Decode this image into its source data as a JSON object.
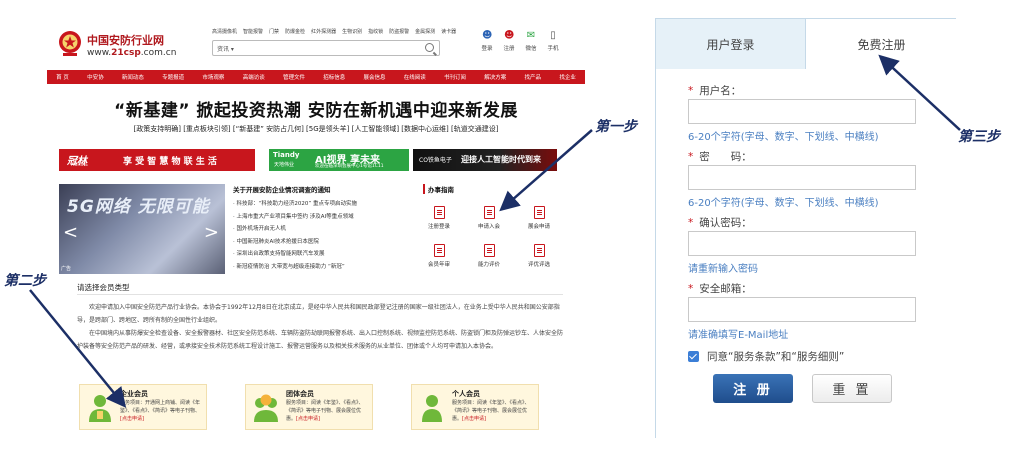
{
  "site": {
    "logo_text": "中国安防行业网",
    "logo_url_prefix": "www.",
    "logo_url_brand": "21csp",
    "logo_url_suffix": ".com.cn",
    "top_links": [
      "高清摄像机",
      "智能报警",
      "门禁",
      "防爆金检",
      "红外探测器",
      "生物识别",
      "指纹锁",
      "防盗报警",
      "金属探测",
      "读卡器"
    ],
    "search_select": "资讯",
    "user_icons": [
      {
        "label": "登录",
        "icon": "person-icon",
        "color": "#2b63b5"
      },
      {
        "label": "注册",
        "icon": "person-add-icon",
        "color": "#c8161d"
      },
      {
        "label": "微信",
        "icon": "wechat-icon",
        "color": "#2ca443"
      },
      {
        "label": "手机",
        "icon": "phone-icon",
        "color": "#555555"
      }
    ],
    "nav": [
      "首 页",
      "中安协",
      "新闻动态",
      "专题报道",
      "市场观察",
      "高端访谈",
      "管理文件",
      "招标信息",
      "展会信息",
      "在线阅读",
      "书刊订阅",
      "解决方案",
      "找产品",
      "找企业"
    ],
    "headline": "“新基建” 掀起投资热潮 安防在新机遇中迎来新发展",
    "subhead": "[政策支持明确] [重点板块引领] [“新基建” 安防占几何] [5G是领头羊] [人工智能领域] [数据中心运维] [轨道交通建设]",
    "sublinks": "",
    "ads": {
      "ad1_brand": "冠林",
      "ad1_brand_en": "AURINE",
      "ad1_slogan": "享 受 智 慧 物 联 生 活",
      "ad2_brand": "Tiandy",
      "ad2_brand_cn": "天地伟业",
      "ad2_title": "AI视界 享未来",
      "ad2_sub": "欢迎莅临深圳会展中心1号馆1C11",
      "ad3_brand": "CO铁鱼电子",
      "ad3_slogan": "迎接人工智能时代到来"
    },
    "banner": {
      "text": "5G网络 无限可能",
      "tag": "广告",
      "prev": "<",
      "next": ">"
    },
    "news": {
      "lead": "关于开展安防企业情况调查的通知",
      "items": [
        "科技部：“科技助力经济2020” 重点专项启动实施",
        "上海市重大产业项目集中签约 涉及AI等重点领域",
        "国外机场开启无人机",
        "中国新冠肺炎AI技术抢援日本医院",
        "深圳出台政策支持智能网联汽车发展",
        "新冠疫情防治 大带宽与超级连接助力 “新冠”"
      ]
    },
    "guide": {
      "title": "办事指南",
      "items": [
        {
          "label": "注册登录",
          "icon": "register-doc-icon"
        },
        {
          "label": "申请入会",
          "icon": "apply-doc-icon"
        },
        {
          "label": "展会申请",
          "icon": "exhibit-doc-icon"
        },
        {
          "label": "会员年审",
          "icon": "review-doc-icon"
        },
        {
          "label": "能力评价",
          "icon": "evaluate-doc-icon"
        },
        {
          "label": "评优评选",
          "icon": "award-doc-icon"
        }
      ]
    },
    "select_title": "请选择会员类型",
    "intro": [
      "欢迎申请加入中国安全防范产品行业协会。本协会于1992年12月8日在北京成立，是经中华人民共和国民政部登记注册的国家一级社团法人，在业务上受中华人民共和国公安部指导，是跨部门、跨地区、跨所有制的全国性行业组织。",
      "在中国境内从事防爆安全检查设备、安全报警器材、社区安全防范系统、车辆防盗防劫联网报警系统、出入口控制系统、视频监控防范系统、防盗锁门柜及防弹运钞车、人体安全防护装备等安全防范产品的研发、经营，或承接安全技术防范系统工程设计施工、报警运营服务以及相关技术服务的从业单位、团体或个人均可申请加入本协会。"
    ],
    "members": [
      {
        "name": "企业会员",
        "desc": "服务项目：开通网上商铺、阅读《年鉴》、《看点》、《简讯》等电子刊物、",
        "link": "[点击申请]"
      },
      {
        "name": "团体会员",
        "desc": "服务项目：阅读《年鉴》、《看点》、《简讯》等电子刊物、展会展位优惠。",
        "link": "[点击申请]"
      },
      {
        "name": "个人会员",
        "desc": "服务项目：阅读《年鉴》、《看点》、《简讯》等电子刊物、展会展位优惠。",
        "link": "[点击申请]"
      }
    ]
  },
  "panel": {
    "tab_login": "用户登录",
    "tab_register": "免费注册",
    "fields": [
      {
        "label": "用户名：",
        "hint": "6-20个字符(字母、数字、下划线、中横线)"
      },
      {
        "label": "密　　码：",
        "hint": "6-20个字符(字母、数字、下划线、中横线)"
      },
      {
        "label": "确认密码：",
        "hint": "请重新输入密码"
      },
      {
        "label": "安全邮箱：",
        "hint": "请准确填写E-Mail地址"
      }
    ],
    "required_mark": "*",
    "agree_text": "同意“服务条款”和“服务细则”",
    "register_button": "注 册",
    "reset_button": "重 置"
  },
  "annotations": {
    "step1": "第一步",
    "step2": "第二步",
    "step3": "第三步"
  },
  "colors": {
    "brand_red": "#c8161d",
    "link_blue": "#4a7fc1",
    "annotation_navy": "#1c2f66"
  }
}
